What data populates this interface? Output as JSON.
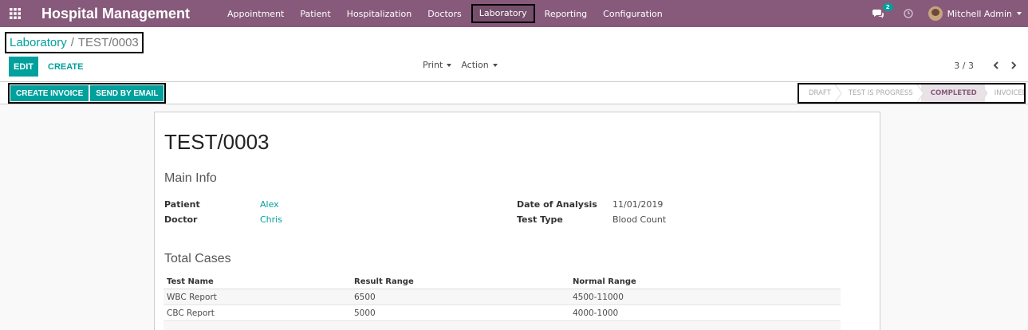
{
  "navbar": {
    "brand": "Hospital Management",
    "menu": [
      {
        "label": "Appointment"
      },
      {
        "label": "Patient"
      },
      {
        "label": "Hospitalization"
      },
      {
        "label": "Doctors"
      },
      {
        "label": "Laboratory"
      },
      {
        "label": "Reporting"
      },
      {
        "label": "Configuration"
      }
    ],
    "active_menu": "Laboratory",
    "chat_badge": "2",
    "user_name": "Mitchell Admin",
    "accent_color": "#875a7b"
  },
  "breadcrumb": {
    "parent": "Laboratory",
    "separator": "/",
    "current": "TEST/0003"
  },
  "toolbar": {
    "edit_label": "EDIT",
    "create_label": "CREATE",
    "print_label": "Print",
    "action_label": "Action",
    "pager": "3 / 3"
  },
  "statusbar": {
    "create_invoice_label": "CREATE INVOICE",
    "send_email_label": "SEND BY EMAIL",
    "stages": [
      {
        "label": "DRAFT"
      },
      {
        "label": "TEST IS PROGRESS"
      },
      {
        "label": "COMPLETED"
      },
      {
        "label": "INVOICED"
      }
    ],
    "current_stage": "COMPLETED"
  },
  "record": {
    "title": "TEST/0003",
    "main_info_title": "Main Info",
    "patient_label": "Patient",
    "patient_value": "Alex",
    "doctor_label": "Doctor",
    "doctor_value": "Chris",
    "date_label": "Date of Analysis",
    "date_value": "11/01/2019",
    "test_type_label": "Test Type",
    "test_type_value": "Blood Count",
    "total_cases_title": "Total Cases",
    "table": {
      "headers": [
        "Test Name",
        "Result Range",
        "Normal Range"
      ],
      "rows": [
        [
          "WBC Report",
          "6500",
          "4500-11000"
        ],
        [
          "CBC Report",
          "5000",
          "4000-1000"
        ]
      ]
    }
  },
  "colors": {
    "primary": "#00a09d",
    "navbar": "#875a7b"
  }
}
